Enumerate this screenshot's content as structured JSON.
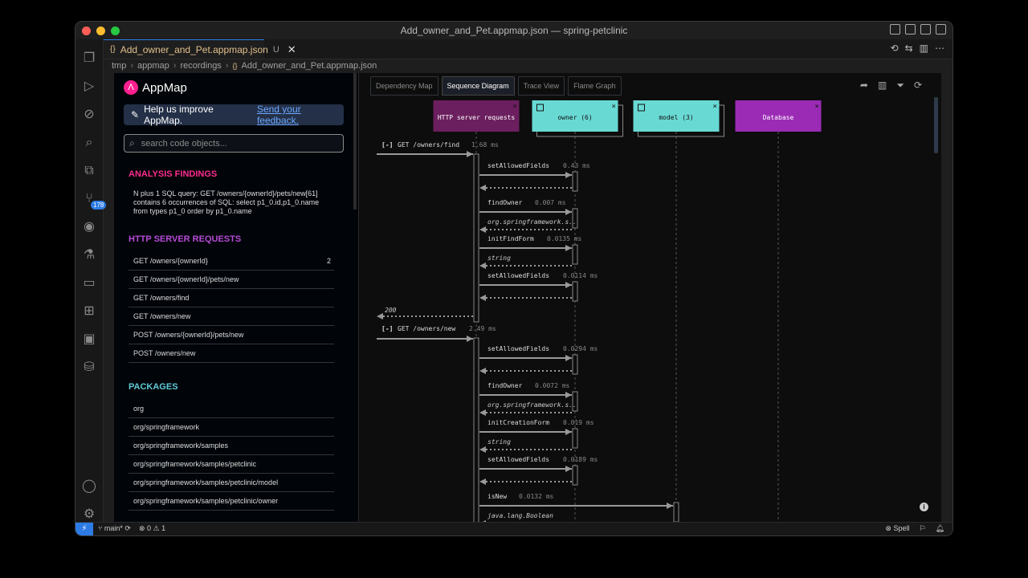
{
  "window": {
    "title": "Add_owner_and_Pet.appmap.json — spring-petclinic"
  },
  "activity": {
    "badge": "178"
  },
  "editor_tab": {
    "label": "Add_owner_and_Pet.appmap.json",
    "modified": "U",
    "icon": "{}"
  },
  "breadcrumb": [
    "tmp",
    "appmap",
    "recordings",
    "Add_owner_and_Pet.appmap.json"
  ],
  "breadcrumb_file_icon": "{}",
  "appmap": {
    "logo_text": "AppMap",
    "feedback_text": "Help us improve AppMap.",
    "feedback_link": "Send your feedback.",
    "search_placeholder": "search code objects...",
    "findings_title": "ANALYSIS FINDINGS",
    "finding": "N plus 1 SQL query: GET /owners/{ownerId}/pets/new[61] contains 6 occurrences of SQL: select p1_0.id,p1_0.name from types p1_0 order by p1_0.name",
    "http_title": "HTTP SERVER REQUESTS",
    "http_requests": [
      {
        "label": "GET /owners/{ownerId}",
        "count": "2"
      },
      {
        "label": "GET /owners/{ownerId}/pets/new",
        "count": ""
      },
      {
        "label": "GET /owners/find",
        "count": ""
      },
      {
        "label": "GET /owners/new",
        "count": ""
      },
      {
        "label": "POST /owners/{ownerId}/pets/new",
        "count": ""
      },
      {
        "label": "POST /owners/new",
        "count": ""
      }
    ],
    "packages_title": "PACKAGES",
    "packages": [
      "org",
      "org/springframework",
      "org/springframework/samples",
      "org/springframework/samples/petclinic",
      "org/springframework/samples/petclinic/model",
      "org/springframework/samples/petclinic/owner"
    ],
    "view_tabs": [
      "Dependency Map",
      "Sequence Diagram",
      "Trace View",
      "Flame Graph"
    ],
    "active_view": "Sequence Diagram",
    "actors": [
      {
        "label": "HTTP server requests",
        "color": "#6b1f5e"
      },
      {
        "label": "owner (6)",
        "color": "#69d9d4"
      },
      {
        "label": "model (3)",
        "color": "#69d9d4"
      },
      {
        "label": "Database",
        "color": "#9b2bb5"
      }
    ],
    "sequence": {
      "request1": {
        "label": "GET /owners/find",
        "toggle": "[-]",
        "duration": "1.68 ms",
        "response": "200"
      },
      "request2": {
        "label": "GET /owners/new",
        "toggle": "[-]",
        "duration": "2.49 ms"
      },
      "calls": [
        {
          "label": "setAllowedFields",
          "duration": "0.43 ms"
        },
        {
          "label": "findOwner",
          "duration": "0.007 ms",
          "returns": "org.springframework.s.."
        },
        {
          "label": "initFindForm",
          "duration": "0.0135 ms",
          "returns": "string"
        },
        {
          "label": "setAllowedFields",
          "duration": "0.0114 ms"
        },
        {
          "label": "setAllowedFields",
          "duration": "0.0294 ms"
        },
        {
          "label": "findOwner",
          "duration": "0.0072 ms",
          "returns": "org.springframework.s.."
        },
        {
          "label": "initCreationForm",
          "duration": "0.019 ms",
          "returns": "string"
        },
        {
          "label": "setAllowedFields",
          "duration": "0.0189 ms"
        },
        {
          "label": "isNew",
          "duration": "0.0132 ms",
          "returns": "java.lang.Boolean"
        }
      ]
    }
  },
  "status": {
    "branch": "main*",
    "errors": "0",
    "warnings": "1",
    "spell": "Spell"
  },
  "colors": {
    "accent": "#2d7be5",
    "findings": "#ff2d8e",
    "http": "#b64bd8",
    "packages": "#5fc9d6"
  }
}
